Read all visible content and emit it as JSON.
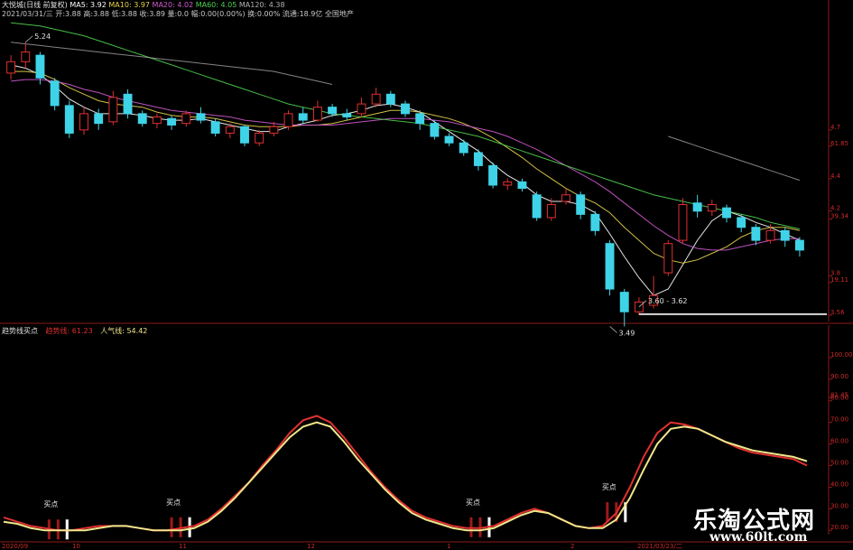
{
  "header": {
    "title": "大悦城(日线 前复权)",
    "ma_items": [
      {
        "label": "MA5: 3.92",
        "color": "#ffffff"
      },
      {
        "label": "MA10: 3.97",
        "color": "#e8d44d"
      },
      {
        "label": "MA20: 4.02",
        "color": "#d05ad0"
      },
      {
        "label": "MA60: 4.05",
        "color": "#4fd04f"
      },
      {
        "label": "MA120: 4.38",
        "color": "#b0b0b0"
      }
    ],
    "info": "2021/03/31/三 开:3.88 高:3.88 低:3.88 收:3.89 量:0.0 幅:0.00(0.00%) 换:0.00% 流通:18.9亿 全国地产"
  },
  "indicator": {
    "title": "趋势线买点",
    "trend_label": "趋势线: 61.23",
    "pop_label": "人气线: 54.42",
    "trend_color": "#e03030",
    "pop_color": "#f0e68c"
  },
  "colors": {
    "up": "#e03030",
    "down": "#3fd3e8",
    "axis": "#8b1a1a",
    "guide": "#d8d8d8"
  },
  "watermark": {
    "line1": "乐淘公式网",
    "line2": "www.60lt.com"
  },
  "chart_data": [
    {
      "type": "candlestick",
      "y_ticks": [
        {
          "value": 4.7,
          "label": "4.7"
        },
        {
          "value": 4.6,
          "label": "61.85"
        },
        {
          "value": 4.4,
          "label": "4.4"
        },
        {
          "value": 4.2,
          "label": "4.2"
        },
        {
          "value": 4.15,
          "label": "39.34"
        },
        {
          "value": 3.8,
          "label": "3.8"
        },
        {
          "value": 3.76,
          "label": "19.11"
        },
        {
          "value": 3.56,
          "label": "3.56"
        }
      ],
      "ylim": [
        3.52,
        5.4
      ],
      "annotations": [
        {
          "text": "5.24",
          "index": 1,
          "value": 5.24
        },
        {
          "text": "3.49",
          "index": 41,
          "value": 3.49
        },
        {
          "text": "3.60 - 3.62",
          "index": 43,
          "value": 3.61
        }
      ],
      "support_level": 3.61,
      "candles": [
        {
          "o": 5.05,
          "c": 5.12,
          "h": 5.16,
          "l": 5.01
        },
        {
          "o": 5.12,
          "c": 5.18,
          "h": 5.24,
          "l": 5.08
        },
        {
          "o": 5.16,
          "c": 5.02,
          "h": 5.18,
          "l": 4.98
        },
        {
          "o": 5.0,
          "c": 4.85,
          "h": 5.02,
          "l": 4.82
        },
        {
          "o": 4.85,
          "c": 4.68,
          "h": 4.88,
          "l": 4.65
        },
        {
          "o": 4.7,
          "c": 4.8,
          "h": 4.84,
          "l": 4.67
        },
        {
          "o": 4.8,
          "c": 4.74,
          "h": 4.83,
          "l": 4.7
        },
        {
          "o": 4.75,
          "c": 4.9,
          "h": 4.94,
          "l": 4.73
        },
        {
          "o": 4.92,
          "c": 4.8,
          "h": 4.95,
          "l": 4.77
        },
        {
          "o": 4.8,
          "c": 4.74,
          "h": 4.82,
          "l": 4.72
        },
        {
          "o": 4.74,
          "c": 4.78,
          "h": 4.8,
          "l": 4.71
        },
        {
          "o": 4.77,
          "c": 4.73,
          "h": 4.79,
          "l": 4.7
        },
        {
          "o": 4.74,
          "c": 4.8,
          "h": 4.82,
          "l": 4.72
        },
        {
          "o": 4.8,
          "c": 4.76,
          "h": 4.84,
          "l": 4.74
        },
        {
          "o": 4.75,
          "c": 4.68,
          "h": 4.77,
          "l": 4.66
        },
        {
          "o": 4.68,
          "c": 4.72,
          "h": 4.74,
          "l": 4.65
        },
        {
          "o": 4.72,
          "c": 4.62,
          "h": 4.73,
          "l": 4.6
        },
        {
          "o": 4.62,
          "c": 4.68,
          "h": 4.7,
          "l": 4.6
        },
        {
          "o": 4.68,
          "c": 4.72,
          "h": 4.75,
          "l": 4.66
        },
        {
          "o": 4.72,
          "c": 4.8,
          "h": 4.82,
          "l": 4.7
        },
        {
          "o": 4.8,
          "c": 4.76,
          "h": 4.84,
          "l": 4.74
        },
        {
          "o": 4.76,
          "c": 4.84,
          "h": 4.88,
          "l": 4.75
        },
        {
          "o": 4.84,
          "c": 4.8,
          "h": 4.86,
          "l": 4.78
        },
        {
          "o": 4.8,
          "c": 4.78,
          "h": 4.83,
          "l": 4.76
        },
        {
          "o": 4.8,
          "c": 4.86,
          "h": 4.9,
          "l": 4.78
        },
        {
          "o": 4.86,
          "c": 4.92,
          "h": 4.96,
          "l": 4.84
        },
        {
          "o": 4.92,
          "c": 4.86,
          "h": 4.94,
          "l": 4.84
        },
        {
          "o": 4.86,
          "c": 4.8,
          "h": 4.88,
          "l": 4.78
        },
        {
          "o": 4.8,
          "c": 4.74,
          "h": 4.82,
          "l": 4.7
        },
        {
          "o": 4.74,
          "c": 4.66,
          "h": 4.76,
          "l": 4.64
        },
        {
          "o": 4.66,
          "c": 4.62,
          "h": 4.68,
          "l": 4.6
        },
        {
          "o": 4.62,
          "c": 4.56,
          "h": 4.64,
          "l": 4.54
        },
        {
          "o": 4.56,
          "c": 4.48,
          "h": 4.58,
          "l": 4.45
        },
        {
          "o": 4.48,
          "c": 4.36,
          "h": 4.5,
          "l": 4.34
        },
        {
          "o": 4.36,
          "c": 4.38,
          "h": 4.4,
          "l": 4.33
        },
        {
          "o": 4.38,
          "c": 4.34,
          "h": 4.4,
          "l": 4.32
        },
        {
          "o": 4.3,
          "c": 4.16,
          "h": 4.32,
          "l": 4.14
        },
        {
          "o": 4.16,
          "c": 4.24,
          "h": 4.28,
          "l": 4.14
        },
        {
          "o": 4.26,
          "c": 4.3,
          "h": 4.34,
          "l": 4.24
        },
        {
          "o": 4.3,
          "c": 4.18,
          "h": 4.32,
          "l": 4.15
        },
        {
          "o": 4.18,
          "c": 4.08,
          "h": 4.2,
          "l": 4.05
        },
        {
          "o": 4.0,
          "c": 3.72,
          "h": 4.02,
          "l": 3.68
        },
        {
          "o": 3.7,
          "c": 3.58,
          "h": 3.72,
          "l": 3.49
        },
        {
          "o": 3.58,
          "c": 3.64,
          "h": 3.67,
          "l": 3.56
        },
        {
          "o": 3.62,
          "c": 3.68,
          "h": 3.8,
          "l": 3.6
        },
        {
          "o": 3.82,
          "c": 4.0,
          "h": 4.02,
          "l": 3.8
        },
        {
          "o": 4.02,
          "c": 4.24,
          "h": 4.28,
          "l": 4.0
        },
        {
          "o": 4.25,
          "c": 4.2,
          "h": 4.3,
          "l": 4.16
        },
        {
          "o": 4.2,
          "c": 4.24,
          "h": 4.27,
          "l": 4.17
        },
        {
          "o": 4.22,
          "c": 4.16,
          "h": 4.24,
          "l": 4.13
        },
        {
          "o": 4.16,
          "c": 4.1,
          "h": 4.18,
          "l": 4.07
        },
        {
          "o": 4.1,
          "c": 4.02,
          "h": 4.12,
          "l": 3.99
        },
        {
          "o": 4.02,
          "c": 4.08,
          "h": 4.12,
          "l": 4.0
        },
        {
          "o": 4.08,
          "c": 4.02,
          "h": 4.1,
          "l": 3.98
        },
        {
          "o": 4.02,
          "c": 3.96,
          "h": 4.04,
          "l": 3.92
        }
      ],
      "lines": [
        {
          "name": "MA5",
          "color": "#ffffff",
          "values": [
            5.1,
            5.08,
            5.04,
            4.97,
            4.89,
            4.84,
            4.8,
            4.8,
            4.8,
            4.79,
            4.77,
            4.76,
            4.76,
            4.77,
            4.75,
            4.73,
            4.71,
            4.69,
            4.69,
            4.72,
            4.74,
            4.76,
            4.79,
            4.8,
            4.82,
            4.85,
            4.86,
            4.84,
            4.81,
            4.75,
            4.69,
            4.63,
            4.57,
            4.49,
            4.42,
            4.37,
            4.3,
            4.26,
            4.26,
            4.24,
            4.19,
            4.06,
            3.92,
            3.79,
            3.68,
            3.72,
            3.87,
            4.02,
            4.14,
            4.2,
            4.17,
            4.13,
            4.1,
            4.06,
            4.02
          ]
        },
        {
          "name": "MA10",
          "color": "#e8d44d",
          "values": [
            5.06,
            5.06,
            5.05,
            5.01,
            4.96,
            4.92,
            4.88,
            4.86,
            4.85,
            4.84,
            4.81,
            4.79,
            4.78,
            4.78,
            4.77,
            4.75,
            4.73,
            4.72,
            4.72,
            4.72,
            4.73,
            4.73,
            4.74,
            4.76,
            4.78,
            4.8,
            4.82,
            4.82,
            4.81,
            4.79,
            4.77,
            4.74,
            4.7,
            4.65,
            4.59,
            4.53,
            4.46,
            4.4,
            4.34,
            4.29,
            4.25,
            4.19,
            4.1,
            4.02,
            3.94,
            3.9,
            3.88,
            3.9,
            3.94,
            3.98,
            4.04,
            4.08,
            4.1,
            4.1,
            4.08
          ]
        },
        {
          "name": "MA20",
          "color": "#d05ad0",
          "values": [
            5.0,
            5.01,
            5.01,
            5.0,
            4.98,
            4.95,
            4.93,
            4.9,
            4.88,
            4.86,
            4.84,
            4.82,
            4.81,
            4.8,
            4.79,
            4.78,
            4.76,
            4.75,
            4.74,
            4.73,
            4.73,
            4.73,
            4.73,
            4.74,
            4.75,
            4.76,
            4.77,
            4.77,
            4.77,
            4.76,
            4.75,
            4.73,
            4.71,
            4.69,
            4.66,
            4.62,
            4.58,
            4.53,
            4.48,
            4.43,
            4.38,
            4.32,
            4.25,
            4.18,
            4.11,
            4.05,
            4.0,
            3.97,
            3.96,
            3.96,
            3.98,
            4.0,
            4.02,
            4.03,
            4.03
          ]
        },
        {
          "name": "MA60",
          "color": "#4fd04f",
          "values": [
            5.36,
            5.35,
            5.34,
            5.32,
            5.3,
            5.28,
            5.25,
            5.22,
            5.19,
            5.16,
            5.13,
            5.1,
            5.07,
            5.04,
            5.01,
            4.98,
            4.95,
            4.92,
            4.89,
            4.86,
            4.84,
            4.82,
            4.8,
            4.79,
            4.78,
            4.77,
            4.76,
            4.75,
            4.74,
            4.72,
            4.7,
            4.68,
            4.66,
            4.63,
            4.6,
            4.57,
            4.54,
            4.51,
            4.48,
            4.45,
            4.42,
            4.39,
            4.36,
            4.33,
            4.3,
            4.28,
            4.26,
            4.24,
            4.22,
            4.2,
            4.18,
            4.16,
            4.13,
            4.11,
            4.09
          ]
        },
        {
          "name": "MA120",
          "color": "#b0b0b0",
          "values": [
            5.24,
            5.23,
            5.22,
            5.21,
            5.2,
            5.19,
            5.18,
            5.17,
            5.16,
            5.15,
            5.14,
            5.13,
            5.12,
            5.11,
            5.1,
            5.09,
            5.08,
            5.07,
            5.06,
            5.04,
            5.02,
            5.0,
            4.98,
            null,
            null,
            null,
            null,
            null,
            null,
            null,
            null,
            null,
            null,
            null,
            null,
            null,
            null,
            null,
            null,
            null,
            null,
            null,
            null,
            null,
            null,
            4.66,
            4.63,
            4.6,
            4.57,
            4.54,
            4.51,
            4.48,
            4.45,
            4.42,
            4.39
          ]
        }
      ]
    },
    {
      "type": "line",
      "ylim": [
        18,
        110
      ],
      "y_ticks": [
        {
          "value": 100,
          "label": "100.00"
        },
        {
          "value": 90,
          "label": "90.00"
        },
        {
          "value": 81.45,
          "label": "81.45"
        },
        {
          "value": 80,
          "label": "80.00"
        },
        {
          "value": 70,
          "label": "70.00"
        },
        {
          "value": 60,
          "label": "60.00"
        },
        {
          "value": 50,
          "label": "50.00"
        },
        {
          "value": 40,
          "label": "40.00"
        },
        {
          "value": 30,
          "label": "30.00"
        },
        {
          "value": 20,
          "label": "20.00"
        }
      ],
      "series": [
        {
          "name": "趋势线",
          "color": "#e03030",
          "values": [
            26,
            24,
            22,
            21,
            20,
            20,
            21,
            22,
            22,
            22,
            21,
            20,
            20,
            21,
            22,
            25,
            30,
            36,
            42,
            50,
            57,
            65,
            71,
            73,
            70,
            63,
            55,
            47,
            40,
            34,
            29,
            26,
            24,
            22,
            21,
            21,
            22,
            25,
            28,
            30,
            28,
            25,
            22,
            21,
            22,
            28,
            40,
            54,
            65,
            70,
            69,
            67,
            64,
            61,
            58,
            56,
            55,
            54,
            53,
            50
          ]
        },
        {
          "name": "人气线",
          "color": "#f0e68c",
          "values": [
            24,
            23,
            21,
            20,
            20,
            20,
            20,
            21,
            22,
            22,
            21,
            20,
            20,
            20,
            21,
            24,
            29,
            35,
            42,
            49,
            56,
            63,
            68,
            70,
            68,
            61,
            53,
            46,
            39,
            33,
            28,
            25,
            23,
            21,
            20,
            20,
            21,
            24,
            27,
            29,
            28,
            25,
            22,
            21,
            21,
            25,
            35,
            48,
            60,
            67,
            68,
            67,
            64,
            61,
            59,
            57,
            56,
            55,
            54,
            52
          ]
        }
      ],
      "buy_points": [
        {
          "label": "买点",
          "index": 4
        },
        {
          "label": "买点",
          "index": 13
        },
        {
          "label": "买点",
          "index": 35
        },
        {
          "label": "买点",
          "index": 45
        }
      ],
      "x_labels": [
        "2020/09",
        "10",
        "11",
        "12",
        "1",
        "2",
        "2021/03/23/二"
      ]
    }
  ]
}
